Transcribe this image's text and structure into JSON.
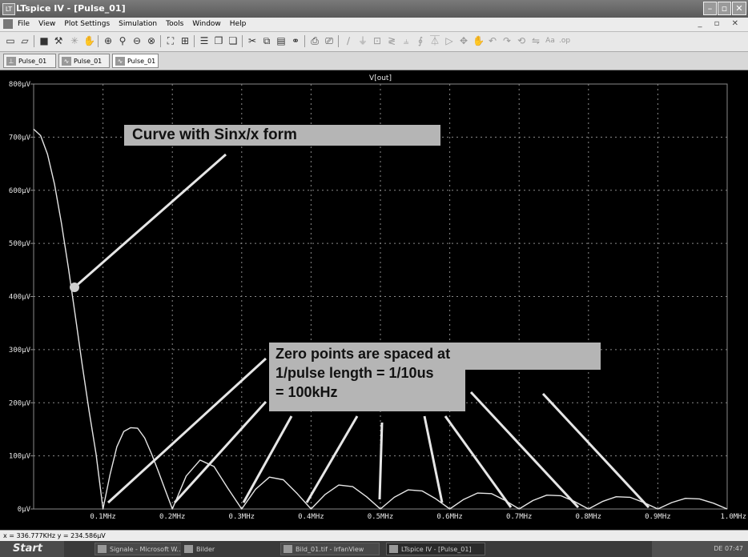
{
  "window": {
    "title": "LTspice IV - [Pulse_01]"
  },
  "menu": [
    "File",
    "View",
    "Plot Settings",
    "Simulation",
    "Tools",
    "Window",
    "Help"
  ],
  "tabs": [
    "Pulse_01",
    "Pulse_01",
    "Pulse_01"
  ],
  "annotations": {
    "sinx": "Curve with Sinx/x form",
    "zero_line1": "Zero points are spaced at",
    "zero_line2": "1/pulse length = 1/10us",
    "zero_line3": "= 100kHz"
  },
  "status": {
    "cursor": "x = 336.777KHz   y = 234.586µV"
  },
  "taskbar": {
    "start": "Start",
    "tasks": [
      "Signale - Microsoft W...",
      "Bilder",
      "Bild_01.tif - IrfanView",
      "LTspice IV - [Pulse_01]"
    ],
    "tray": "DE  07:47"
  },
  "colors": {
    "background": "#000000",
    "trace": "#e6e6e6",
    "grid": "#8a8a8a",
    "callout": "#b5b5b5"
  },
  "chart_data": {
    "type": "line",
    "title": "V[out]",
    "xlabel": "",
    "ylabel": "",
    "xlim": [
      0,
      1.0
    ],
    "ylim": [
      0,
      800
    ],
    "x_unit": "MHz",
    "y_unit": "µV",
    "x_ticks": [
      "0.1MHz",
      "0.2MHz",
      "0.3MHz",
      "0.4MHz",
      "0.5MHz",
      "0.6MHz",
      "0.7MHz",
      "0.8MHz",
      "0.9MHz",
      "1.0MHz"
    ],
    "y_ticks": [
      "0µV",
      "100µV",
      "200µV",
      "300µV",
      "400µV",
      "500µV",
      "600µV",
      "700µV",
      "800µV"
    ],
    "grid": true,
    "series": [
      {
        "name": "V[out]",
        "x": [
          0.0,
          0.01,
          0.02,
          0.03,
          0.04,
          0.05,
          0.06,
          0.07,
          0.08,
          0.09,
          0.1,
          0.11,
          0.12,
          0.13,
          0.14,
          0.15,
          0.16,
          0.17,
          0.18,
          0.19,
          0.2,
          0.22,
          0.24,
          0.26,
          0.28,
          0.3,
          0.32,
          0.34,
          0.36,
          0.38,
          0.4,
          0.42,
          0.44,
          0.46,
          0.48,
          0.5,
          0.52,
          0.54,
          0.56,
          0.58,
          0.6,
          0.62,
          0.64,
          0.66,
          0.68,
          0.7,
          0.72,
          0.74,
          0.76,
          0.78,
          0.8,
          0.82,
          0.84,
          0.86,
          0.88,
          0.9,
          0.92,
          0.94,
          0.96,
          0.98,
          1.0
        ],
        "y": [
          715,
          703,
          668,
          612,
          539,
          455,
          364,
          272,
          184,
          104,
          0,
          64,
          117,
          146,
          153,
          152,
          134,
          104,
          70,
          35,
          0,
          62,
          92,
          80,
          39,
          0,
          37,
          60,
          55,
          29,
          0,
          27,
          45,
          42,
          23,
          0,
          22,
          36,
          34,
          19,
          0,
          18,
          30,
          29,
          16,
          0,
          16,
          26,
          25,
          14,
          0,
          14,
          23,
          22,
          12,
          0,
          12,
          20,
          19,
          11,
          0
        ]
      }
    ]
  }
}
